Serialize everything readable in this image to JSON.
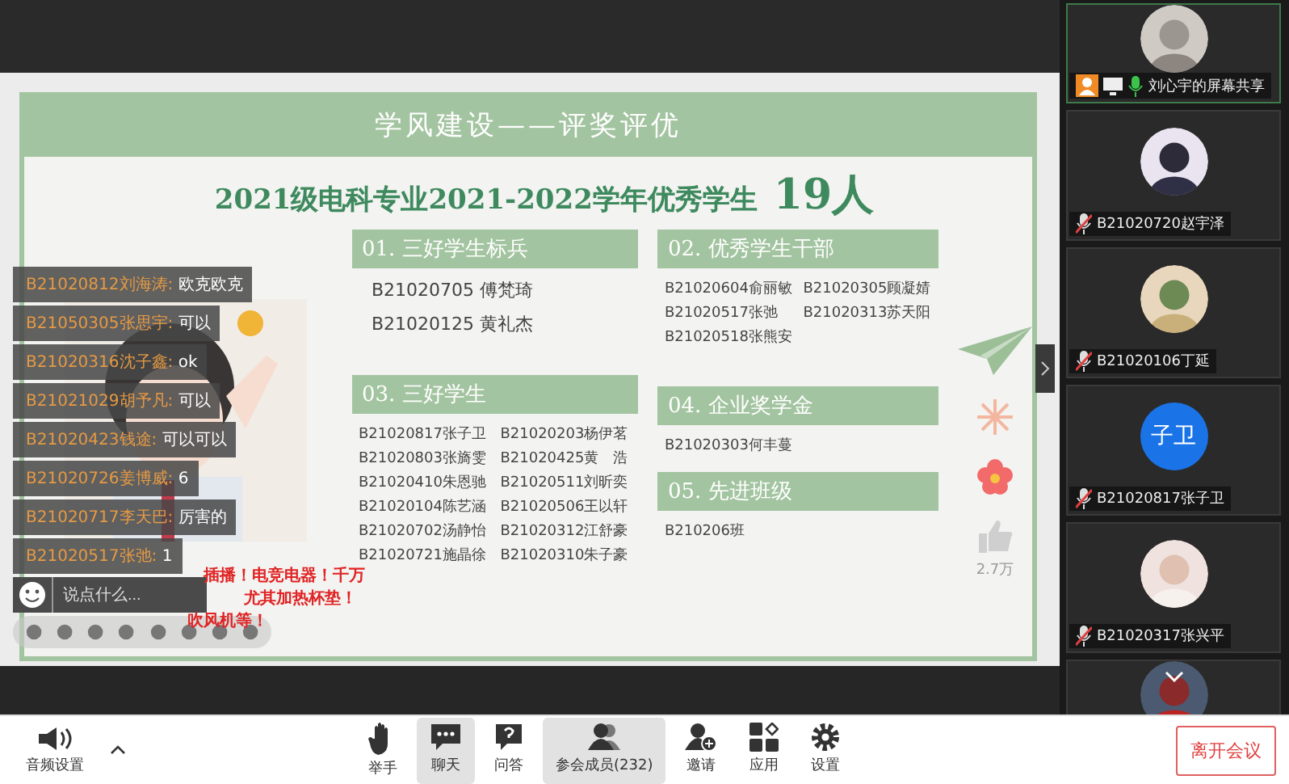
{
  "slide": {
    "banner": "学风建设——评奖评优",
    "title": "2021级电科专业2021-2022学年优秀学生",
    "count": "19人",
    "like_count": "2.7万",
    "sections": [
      {
        "heading": "01. 三好学生标兵",
        "kind": "single",
        "names": [
          "B21020705 傅梵琦",
          "B21020125 黄礼杰"
        ]
      },
      {
        "heading": "02. 优秀学生干部",
        "kind": "double",
        "names": [
          "B21020604俞丽敏",
          "B21020305顾凝婧",
          "B21020517张弛",
          "B21020313苏天阳",
          "B21020518张熊安"
        ]
      },
      {
        "heading": "03. 三好学生",
        "kind": "double",
        "names": [
          "B21020817张子卫",
          "B21020203杨伊茗",
          "B21020803张旖雯",
          "B21020425黄　浩",
          "B21020410朱恩驰",
          "B21020511刘昕奕",
          "B21020104陈艺涵",
          "B21020506王以轩",
          "B21020702汤静怡",
          "B21020312江舒豪",
          "B21020721施晶徐",
          "B21020310朱子豪"
        ]
      },
      {
        "heading": "04. 企业奖学金",
        "kind": "single",
        "names": [
          "B21020303何丰蔓"
        ]
      },
      {
        "heading": "05. 先进班级",
        "kind": "single",
        "names": [
          "B210206班"
        ]
      }
    ]
  },
  "chat": {
    "messages": [
      {
        "sender": "B21020812刘海涛:",
        "text": "欧克欧克"
      },
      {
        "sender": "B21050305张思宇:",
        "text": "可以"
      },
      {
        "sender": "B21020316沈子鑫:",
        "text": "ok"
      },
      {
        "sender": "B21021029胡予凡:",
        "text": "可以"
      },
      {
        "sender": "B21020423钱途:",
        "text": "可以可以"
      },
      {
        "sender": "B21020726姜博威:",
        "text": "6"
      },
      {
        "sender": "B21020717李天巴:",
        "text": "厉害的"
      },
      {
        "sender": "B21020517张弛:",
        "text": "1"
      }
    ],
    "placeholder": "说点什么...",
    "danmaku": [
      "插播！电竞电器！千万",
      "尤其加热杯垫！",
      "吹风机等！"
    ]
  },
  "participants": [
    {
      "name": "刘心宇的屏幕共享",
      "kind": "picture",
      "muted": false,
      "sharing": true
    },
    {
      "name": "B21020720赵宇泽",
      "kind": "picture",
      "muted": true,
      "sharing": false
    },
    {
      "name": "B21020106丁延",
      "kind": "picture",
      "muted": true,
      "sharing": false
    },
    {
      "name": "B21020817张子卫",
      "kind": "initials",
      "initials": "子卫",
      "muted": true,
      "sharing": false
    },
    {
      "name": "B21020317张兴平",
      "kind": "picture",
      "muted": true,
      "sharing": false
    },
    {
      "kind": "picture"
    }
  ],
  "toolbar": {
    "audio": "音频设置",
    "buttons": [
      {
        "label": "举手",
        "kind": "hand",
        "selected": false
      },
      {
        "label": "聊天",
        "kind": "chat",
        "selected": true
      },
      {
        "label": "问答",
        "kind": "qa",
        "selected": false
      },
      {
        "label": "参会成员(232)",
        "kind": "members",
        "selected": true
      },
      {
        "label": "邀请",
        "kind": "invite",
        "selected": false
      },
      {
        "label": "应用",
        "kind": "apps",
        "selected": false
      },
      {
        "label": "设置",
        "kind": "settings",
        "selected": false
      }
    ],
    "leave": "离开会议"
  }
}
